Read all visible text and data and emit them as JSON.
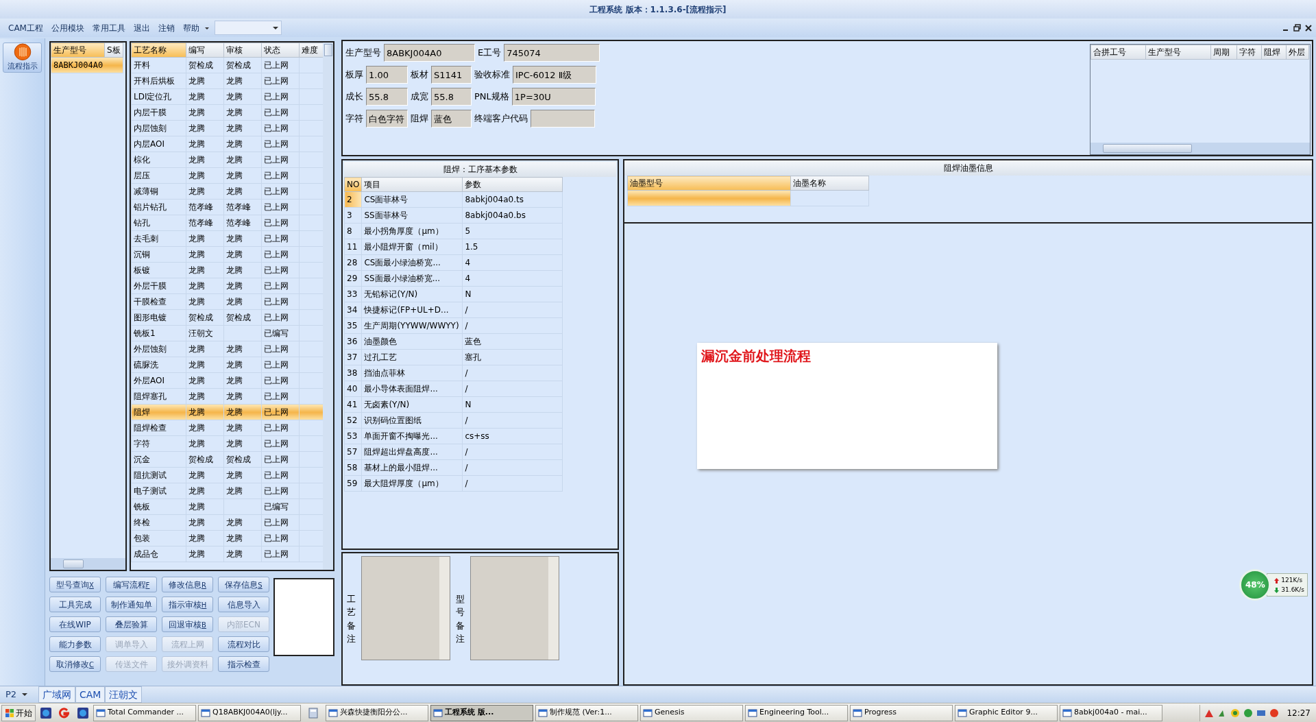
{
  "window": {
    "title": "工程系统 版本：1.1.3.6-[流程指示]"
  },
  "menu": [
    {
      "label": "CAM工程"
    },
    {
      "label": "公用模块"
    },
    {
      "label": "常用工具"
    },
    {
      "label": "退出"
    },
    {
      "label": "注销"
    },
    {
      "label": "帮助"
    }
  ],
  "nav": [
    {
      "label": "流程指示",
      "selected": true
    }
  ],
  "models": {
    "columns": [
      "生产型号",
      "S板"
    ],
    "rows": [
      {
        "model": "8ABKJ004A0",
        "selected": true
      }
    ]
  },
  "processes": {
    "columns": [
      "工艺名称",
      "编写",
      "审核",
      "状态",
      "难度"
    ],
    "rows": [
      {
        "name": "开料",
        "writer": "贺检成",
        "reviewer": "贺检成",
        "status": "已上网",
        "selected": false
      },
      {
        "name": "开料后烘板",
        "writer": "龙腾",
        "reviewer": "龙腾",
        "status": "已上网",
        "selected": false
      },
      {
        "name": "LDI定位孔",
        "writer": "龙腾",
        "reviewer": "龙腾",
        "status": "已上网",
        "selected": false
      },
      {
        "name": "内层干膜",
        "writer": "龙腾",
        "reviewer": "龙腾",
        "status": "已上网",
        "selected": false
      },
      {
        "name": "内层蚀刻",
        "writer": "龙腾",
        "reviewer": "龙腾",
        "status": "已上网",
        "selected": false
      },
      {
        "name": "内层AOI",
        "writer": "龙腾",
        "reviewer": "龙腾",
        "status": "已上网",
        "selected": false
      },
      {
        "name": "棕化",
        "writer": "龙腾",
        "reviewer": "龙腾",
        "status": "已上网",
        "selected": false
      },
      {
        "name": "层压",
        "writer": "龙腾",
        "reviewer": "龙腾",
        "status": "已上网",
        "selected": false
      },
      {
        "name": "减薄铜",
        "writer": "龙腾",
        "reviewer": "龙腾",
        "status": "已上网",
        "selected": false
      },
      {
        "name": "铝片钻孔",
        "writer": "范孝峰",
        "reviewer": "范孝峰",
        "status": "已上网",
        "selected": false
      },
      {
        "name": "钻孔",
        "writer": "范孝峰",
        "reviewer": "范孝峰",
        "status": "已上网",
        "selected": false
      },
      {
        "name": "去毛刺",
        "writer": "龙腾",
        "reviewer": "龙腾",
        "status": "已上网",
        "selected": false
      },
      {
        "name": "沉铜",
        "writer": "龙腾",
        "reviewer": "龙腾",
        "status": "已上网",
        "selected": false
      },
      {
        "name": "板镀",
        "writer": "龙腾",
        "reviewer": "龙腾",
        "status": "已上网",
        "selected": false
      },
      {
        "name": "外层干膜",
        "writer": "龙腾",
        "reviewer": "龙腾",
        "status": "已上网",
        "selected": false
      },
      {
        "name": "干膜检查",
        "writer": "龙腾",
        "reviewer": "龙腾",
        "status": "已上网",
        "selected": false
      },
      {
        "name": "图形电镀",
        "writer": "贺检成",
        "reviewer": "贺检成",
        "status": "已上网",
        "selected": false
      },
      {
        "name": "铣板1",
        "writer": "汪朝文",
        "status": "已编写",
        "selected": false
      },
      {
        "name": "外层蚀刻",
        "writer": "龙腾",
        "reviewer": "龙腾",
        "status": "已上网",
        "selected": false
      },
      {
        "name": "硫脲洗",
        "writer": "龙腾",
        "reviewer": "龙腾",
        "status": "已上网",
        "selected": false
      },
      {
        "name": "外层AOI",
        "writer": "龙腾",
        "reviewer": "龙腾",
        "status": "已上网",
        "selected": false
      },
      {
        "name": "阻焊塞孔",
        "writer": "龙腾",
        "reviewer": "龙腾",
        "status": "已上网",
        "selected": false
      },
      {
        "name": "阻焊",
        "writer": "龙腾",
        "reviewer": "龙腾",
        "status": "已上网",
        "selected": true
      },
      {
        "name": "阻焊检查",
        "writer": "龙腾",
        "reviewer": "龙腾",
        "status": "已上网",
        "selected": false
      },
      {
        "name": "字符",
        "writer": "龙腾",
        "reviewer": "龙腾",
        "status": "已上网",
        "selected": false
      },
      {
        "name": "沉金",
        "writer": "贺检成",
        "reviewer": "贺检成",
        "status": "已上网",
        "selected": false
      },
      {
        "name": "阻抗测试",
        "writer": "龙腾",
        "reviewer": "龙腾",
        "status": "已上网",
        "selected": false
      },
      {
        "name": "电子测试",
        "writer": "龙腾",
        "reviewer": "龙腾",
        "status": "已上网",
        "selected": false
      },
      {
        "name": "铣板",
        "writer": "龙腾",
        "status": "已编写",
        "selected": false
      },
      {
        "name": "终检",
        "writer": "龙腾",
        "reviewer": "龙腾",
        "status": "已上网",
        "selected": false
      },
      {
        "name": "包装",
        "writer": "龙腾",
        "reviewer": "龙腾",
        "status": "已上网",
        "selected": false
      },
      {
        "name": "成品仓",
        "writer": "龙腾",
        "reviewer": "龙腾",
        "status": "已上网",
        "selected": false
      }
    ]
  },
  "buttons": [
    {
      "label": "型号查询",
      "shortcut": "X",
      "disabled": false
    },
    {
      "label": "编写流程",
      "shortcut": "F",
      "disabled": false
    },
    {
      "label": "修改信息",
      "shortcut": "R",
      "disabled": false
    },
    {
      "label": "保存信息",
      "shortcut": "S",
      "disabled": false
    },
    {
      "label": "工具完成",
      "disabled": false
    },
    {
      "label": "制作通知单",
      "disabled": false
    },
    {
      "label": "指示审核",
      "shortcut": "H",
      "disabled": false
    },
    {
      "label": "信息导入",
      "disabled": false
    },
    {
      "label": "在线WIP",
      "disabled": false
    },
    {
      "label": "叠层验算",
      "disabled": false
    },
    {
      "label": "回退审核",
      "shortcut": "B",
      "disabled": false
    },
    {
      "label": "内部ECN",
      "disabled": true
    },
    {
      "label": "能力参数",
      "disabled": false
    },
    {
      "label": "调单导入",
      "disabled": true
    },
    {
      "label": "流程上网",
      "disabled": true
    },
    {
      "label": "流程对比",
      "disabled": false
    },
    {
      "label": "取消修改",
      "shortcut": "C",
      "disabled": false
    },
    {
      "label": "传送文件",
      "disabled": true
    },
    {
      "label": "接外调资料",
      "disabled": true
    },
    {
      "label": "指示检查",
      "disabled": false
    }
  ],
  "info": [
    [
      {
        "label": "生产型号",
        "value": "8ABKJ004A0"
      },
      {
        "label": "E工号",
        "value": "745074"
      }
    ],
    [
      {
        "label": "板厚",
        "value": "1.00"
      },
      {
        "label": "板材",
        "value": "S1141"
      },
      {
        "label": "验收标准",
        "value": "IPC-6012 Ⅱ级"
      }
    ],
    [
      {
        "label": "成长",
        "value": "55.8"
      },
      {
        "label": "成宽",
        "value": "55.8"
      },
      {
        "label": "PNL规格",
        "value": "1P=30U"
      }
    ],
    [
      {
        "label": "字符",
        "value": "白色字符"
      },
      {
        "label": "阻焊",
        "value": "蓝色"
      },
      {
        "label": "终端客户代码"
      }
    ]
  ],
  "merge_table": {
    "columns": [
      "合拼工号",
      "生产型号",
      "周期",
      "字符",
      "阻焊",
      "外层"
    ]
  },
  "params": {
    "title": "阻焊：工序基本参数",
    "columns": [
      "NO",
      "项目",
      "参数"
    ],
    "rows": [
      {
        "no": "2",
        "item": "CS面菲林号",
        "value": "8abkj004a0.ts",
        "selected": true
      },
      {
        "no": "3",
        "item": "SS面菲林号",
        "value": "8abkj004a0.bs",
        "selected": false
      },
      {
        "no": "8",
        "item": "最小拐角厚度（μm）",
        "value": "5",
        "selected": false
      },
      {
        "no": "11",
        "item": "最小阻焊开窗（mil）",
        "value": "1.5",
        "selected": false
      },
      {
        "no": "28",
        "item": "CS面最小绿油桥宽...",
        "value": "4",
        "selected": false
      },
      {
        "no": "29",
        "item": "SS面最小绿油桥宽...",
        "value": "4",
        "selected": false
      },
      {
        "no": "33",
        "item": "无铅标记(Y/N)",
        "value": "N",
        "selected": false
      },
      {
        "no": "34",
        "item": "快捷标记(FP+UL+D...",
        "value": "/",
        "selected": false
      },
      {
        "no": "35",
        "item": "生产周期(YYWW/WWYY)",
        "value": "/",
        "selected": false
      },
      {
        "no": "36",
        "item": "油墨颜色",
        "value": "蓝色",
        "selected": false
      },
      {
        "no": "37",
        "item": "过孔工艺",
        "value": "塞孔",
        "selected": false
      },
      {
        "no": "38",
        "item": "挡油点菲林",
        "value": "/",
        "selected": false
      },
      {
        "no": "40",
        "item": "最小导体表面阻焊...",
        "value": "/",
        "selected": false
      },
      {
        "no": "41",
        "item": "无卤素(Y/N)",
        "value": "N",
        "selected": false
      },
      {
        "no": "52",
        "item": "识别码位置图纸",
        "value": "/",
        "selected": false
      },
      {
        "no": "53",
        "item": "单面开窗不掏曝光...",
        "value": "cs+ss",
        "selected": false
      },
      {
        "no": "57",
        "item": "阻焊超出焊盘高度...",
        "value": "/",
        "selected": false
      },
      {
        "no": "58",
        "item": "基材上的最小阻焊...",
        "value": "/",
        "selected": false
      },
      {
        "no": "59",
        "item": "最大阻焊厚度（μm）",
        "value": "/",
        "selected": false
      }
    ]
  },
  "notes": [
    {
      "label": "工艺备注"
    },
    {
      "label": "型号备注"
    }
  ],
  "ink": {
    "title": "阻焊油墨信息",
    "columns": [
      "油墨型号",
      "油墨名称"
    ],
    "rows": [
      {
        "selected": true
      }
    ]
  },
  "popup": {
    "text": "漏沉金前处理流程"
  },
  "net_widget": {
    "percent": "48%",
    "up": "121K/s",
    "down": "31.6K/s"
  },
  "status_bar": {
    "page": "P2",
    "tabs": [
      "广域网",
      "CAM",
      "汪朝文"
    ]
  },
  "taskbar": {
    "start": "开始",
    "tasks": [
      {
        "label": "Total Commander ...",
        "selected": false
      },
      {
        "label": "Q18ABKJ004A0(ljy...",
        "selected": false
      },
      {
        "label": "兴森快捷衡阳分公...",
        "selected": false
      },
      {
        "label": "工程系统   版...",
        "selected": true
      },
      {
        "label": "制作规范 (Ver:1...",
        "selected": false
      },
      {
        "label": "Genesis",
        "selected": false
      },
      {
        "label": "Engineering Tool...",
        "selected": false
      },
      {
        "label": "Progress",
        "selected": false
      },
      {
        "label": "Graphic Editor 9...",
        "selected": false
      },
      {
        "label": "8abkj004a0 - mai...",
        "selected": false
      }
    ],
    "clock": "12:27"
  }
}
